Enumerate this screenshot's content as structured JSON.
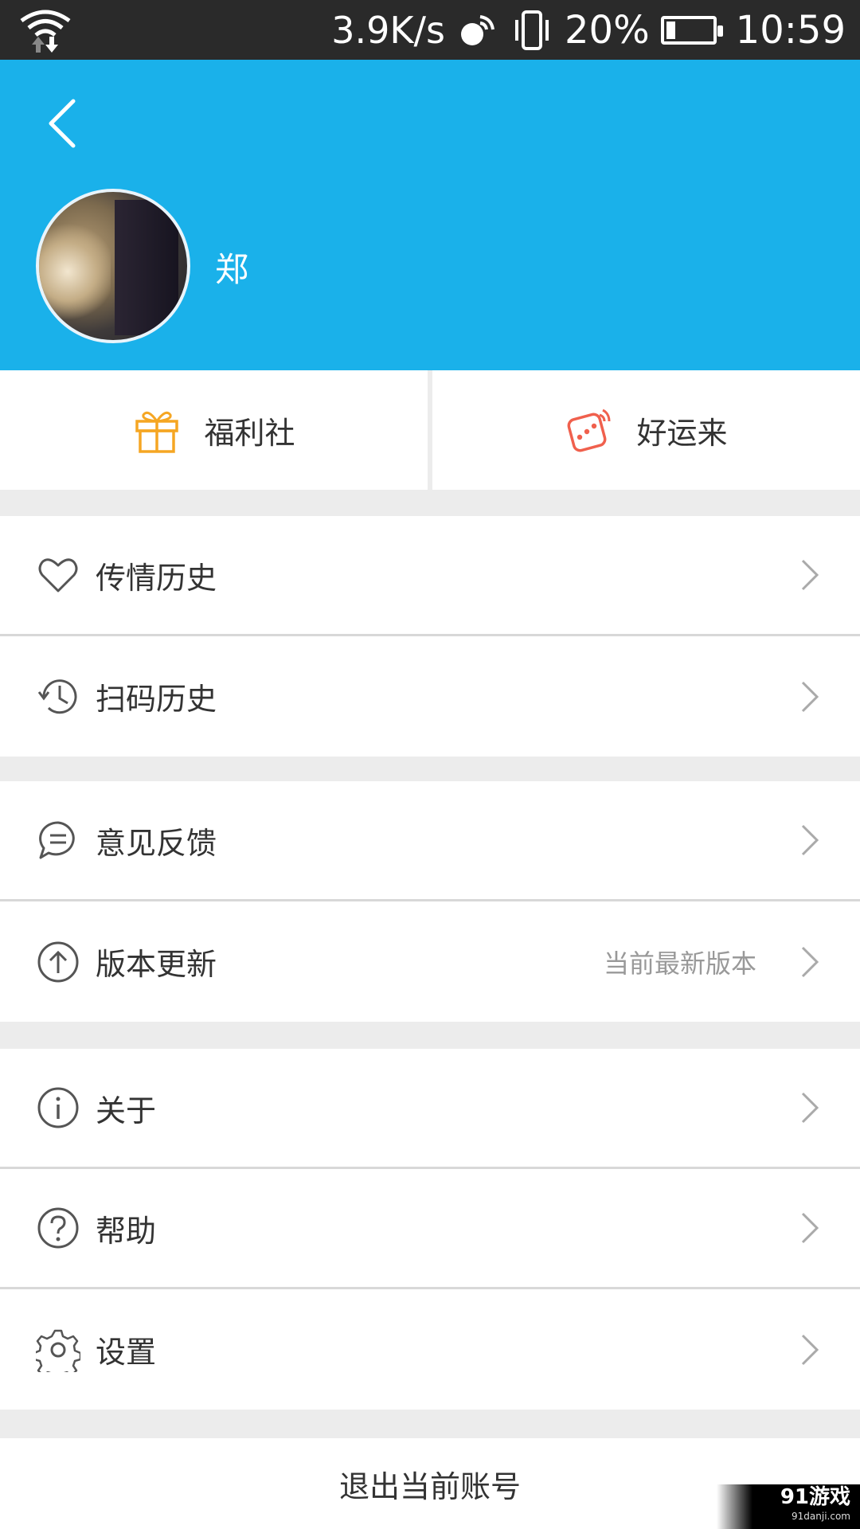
{
  "status_bar": {
    "speed": "3.9K/s",
    "battery": "20%",
    "battery_level": 0.2,
    "time": "10:59"
  },
  "header": {
    "username": "郑",
    "bg_color": "#1ab1ea"
  },
  "quick_actions": [
    {
      "label": "福利社",
      "icon": "gift-icon",
      "color": "#f5a623"
    },
    {
      "label": "好运来",
      "icon": "dice-icon",
      "color": "#f0604d"
    }
  ],
  "menu": {
    "group1": [
      {
        "label": "传情历史",
        "icon": "heart-icon"
      },
      {
        "label": "扫码历史",
        "icon": "history-clock-icon"
      }
    ],
    "group2": [
      {
        "label": "意见反馈",
        "icon": "chat-bubble-icon"
      },
      {
        "label": "版本更新",
        "icon": "upload-arrow-icon",
        "sub": "当前最新版本"
      }
    ],
    "group3": [
      {
        "label": "关于",
        "icon": "info-icon"
      },
      {
        "label": "帮助",
        "icon": "help-icon"
      },
      {
        "label": "设置",
        "icon": "gear-icon"
      }
    ]
  },
  "logout_label": "退出当前账号",
  "watermark": {
    "main": "91游戏",
    "sub": "91danji.com"
  }
}
